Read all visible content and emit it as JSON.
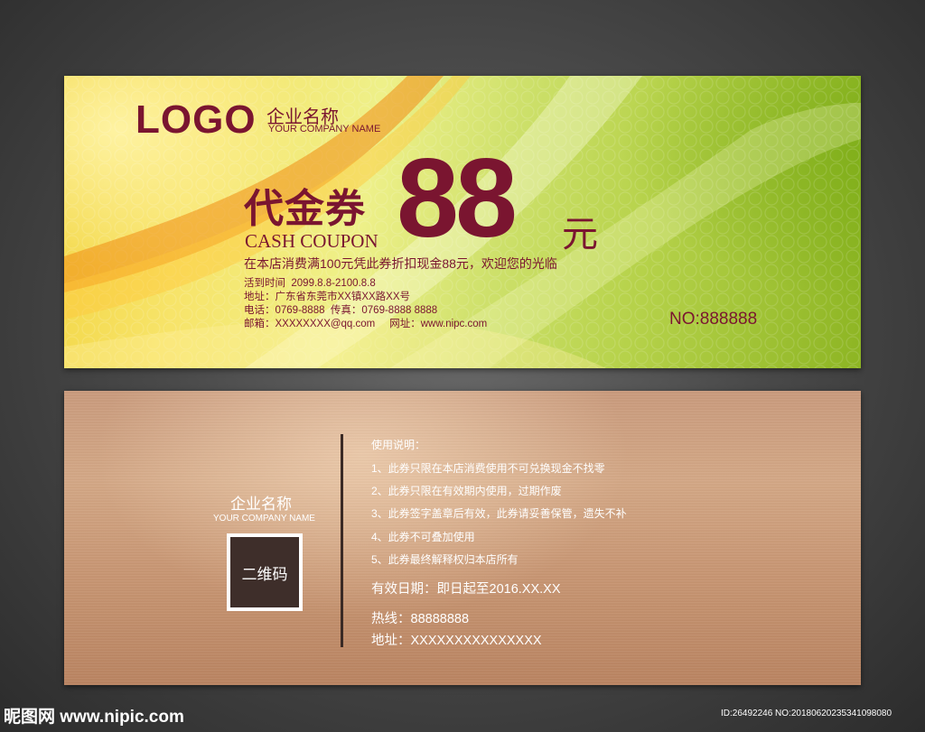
{
  "front": {
    "logo": "LOGO",
    "company_cn": "企业名称",
    "company_en": "YOUR COMPANY NAME",
    "title_cn": "代金券",
    "title_en": "CASH COUPON",
    "amount": "88",
    "currency": "元",
    "description": "在本店消费满100元凭此券折扣现金88元，欢迎您的光临",
    "activity_time": "活到时间  2099.8.8-2100.8.8",
    "address": "地址：广东省东莞市XX镇XX路XX号",
    "phone": "电话：0769-8888  传真：0769-8888 8888",
    "email_web": "邮箱：XXXXXXXX@qq.com     网址：www.nipc.com",
    "number": "NO:888888",
    "colors": {
      "text": "#7a1530",
      "bg_left": "#f3d645",
      "bg_right": "#8db523"
    }
  },
  "back": {
    "company_cn": "企业名称",
    "company_en": "YOUR COMPANY NAME",
    "qr_label": "二维码",
    "usage_title": "使用说明：",
    "rules": [
      "1、此券只限在本店消费使用不可兑换现金不找零",
      "2、此券只限在有效期内使用，过期作废",
      "3、此券签字盖章后有效，此券请妥善保管，遗失不补",
      "4、此券不可叠加使用",
      "5、此券最终解释权归本店所有"
    ],
    "valid_date": "有效日期：即日起至2016.XX.XX",
    "hotline": "热线：88888888",
    "address": "地址：XXXXXXXXXXXXXXX",
    "colors": {
      "bg": "#c99a7c",
      "text": "#ffffff",
      "divider": "#3a2a25"
    }
  },
  "watermark": {
    "left": "昵图网 www.nipic.com",
    "right": "ID:26492246 NO:20180620235341098080"
  }
}
